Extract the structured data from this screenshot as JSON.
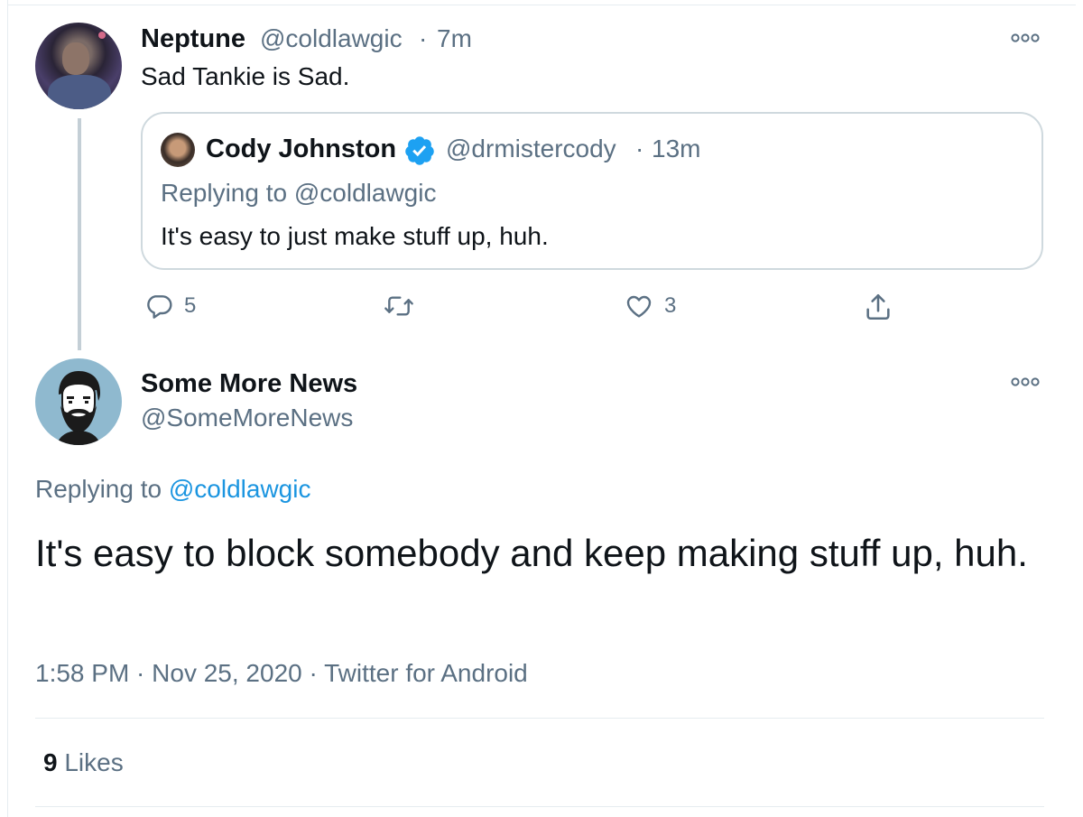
{
  "parent_tweet": {
    "author_name": "Neptune",
    "author_handle": "@coldlawgic",
    "separator": "·",
    "time": "7m",
    "text": "Sad Tankie is Sad.",
    "quoted_tweet": {
      "author_name": "Cody Johnston",
      "verified": true,
      "author_handle": "@drmistercody",
      "separator": "·",
      "time": "13m",
      "replying_to": "Replying to @coldlawgic",
      "text": "It's easy to just make stuff up, huh."
    },
    "actions": {
      "reply_count": "5",
      "retweet_count": "",
      "like_count": "3"
    }
  },
  "main_tweet": {
    "author_name": "Some More News",
    "author_handle": "@SomeMoreNews",
    "replying_to_prefix": "Replying to ",
    "replying_to_mention": "@coldlawgic",
    "text": "It's easy to block somebody and keep making stuff up, huh.",
    "timestamp": "1:58 PM · Nov 25, 2020 · Twitter for Android",
    "likes_count": "9",
    "likes_label": "Likes"
  },
  "colors": {
    "text_primary": "#0f1419",
    "text_secondary": "#5b7083",
    "link": "#1b95e0",
    "verified": "#1da1f2",
    "border": "#cfd9de"
  }
}
